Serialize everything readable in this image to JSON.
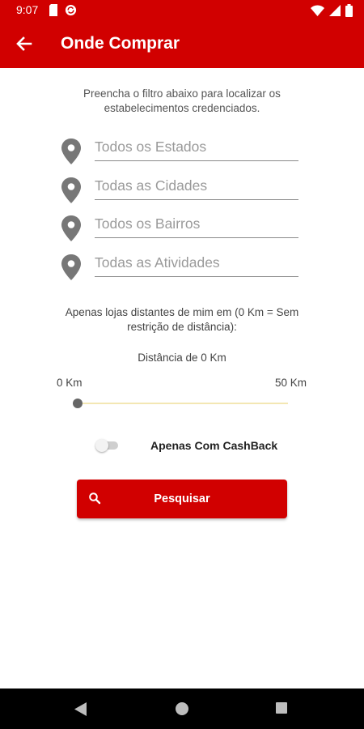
{
  "status_bar": {
    "time": "9:07",
    "left_icons": [
      "sd-card-icon",
      "sync-icon"
    ],
    "right_icons": [
      "wifi-icon",
      "signal-icon",
      "battery-icon"
    ]
  },
  "app_bar": {
    "title": "Onde Comprar",
    "back_icon": "arrow-back-icon",
    "color": "#d10000"
  },
  "intro_text": "Preencha o filtro abaixo para localizar os estabelecimentos credenciados.",
  "filters": [
    {
      "placeholder": "Todos os Estados",
      "value": "",
      "icon": "location-pin-icon"
    },
    {
      "placeholder": "Todas as Cidades",
      "value": "",
      "icon": "location-pin-icon"
    },
    {
      "placeholder": "Todos os Bairros",
      "value": "",
      "icon": "location-pin-icon"
    },
    {
      "placeholder": "Todas as Atividades",
      "value": "",
      "icon": "location-pin-icon"
    }
  ],
  "distance": {
    "description": "Apenas lojas distantes de mim em (0 Km = Sem restrição de distância):",
    "current_label": "Distância de 0 Km",
    "min_label": "0 Km",
    "max_label": "50 Km",
    "current_value": 0,
    "min_value": 0,
    "max_value": 50
  },
  "cashback": {
    "label": "Apenas Com CashBack",
    "enabled": false
  },
  "search_button": {
    "label": "Pesquisar",
    "icon": "search-icon"
  },
  "nav_bar": {
    "buttons": [
      "back-triangle-icon",
      "home-circle-icon",
      "recents-square-icon"
    ]
  }
}
